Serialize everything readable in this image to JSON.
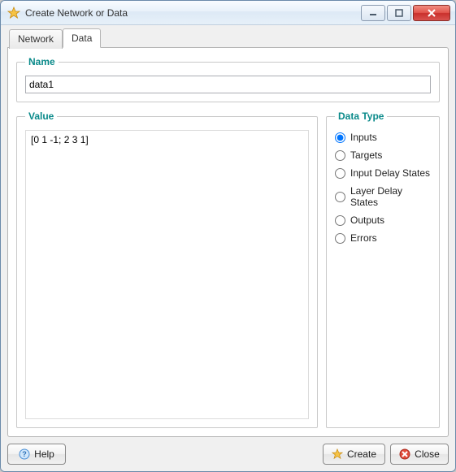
{
  "window": {
    "title": "Create Network or Data"
  },
  "tabs": {
    "network": "Network",
    "data": "Data",
    "active": "data"
  },
  "groups": {
    "name": "Name",
    "value": "Value",
    "dataType": "Data Type"
  },
  "fields": {
    "name_value": "data1",
    "value_text": "[0 1 -1; 2 3 1]"
  },
  "dataType": {
    "selected": "inputs",
    "options": {
      "inputs": "Inputs",
      "targets": "Targets",
      "inputDelay": "Input Delay States",
      "layerDelay": "Layer Delay States",
      "outputs": "Outputs",
      "errors": "Errors"
    }
  },
  "buttons": {
    "help": "Help",
    "create": "Create",
    "close": "Close"
  }
}
